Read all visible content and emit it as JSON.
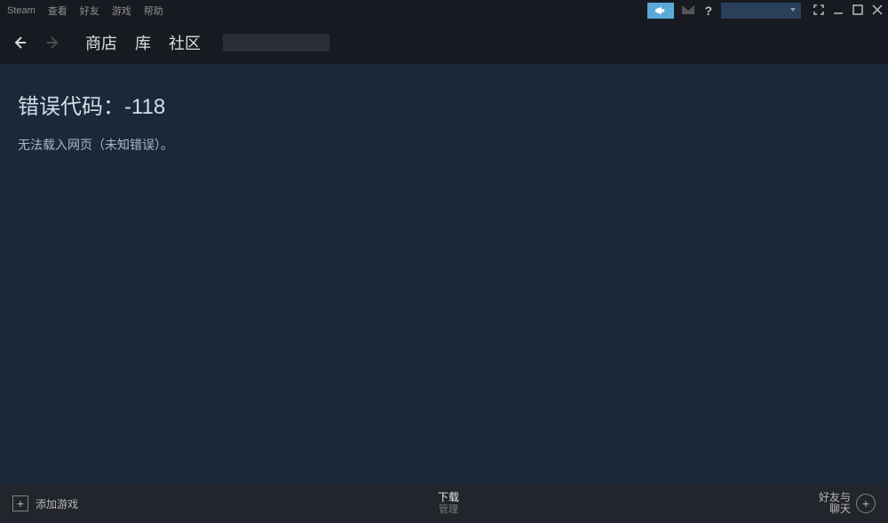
{
  "menubar": {
    "steam": "Steam",
    "items": [
      "查看",
      "好友",
      "游戏",
      "帮助"
    ],
    "help_icon": "?"
  },
  "nav": {
    "tabs": [
      "商店",
      "库",
      "社区"
    ]
  },
  "content": {
    "error_code_label": "错误代码：-118",
    "error_message": "无法载入网页（未知错误）。"
  },
  "footer": {
    "add_game": "添加游戏",
    "downloads": "下载",
    "manage": "管理",
    "friends_chat_l1": "好友与",
    "friends_chat_l2": "聊天"
  }
}
